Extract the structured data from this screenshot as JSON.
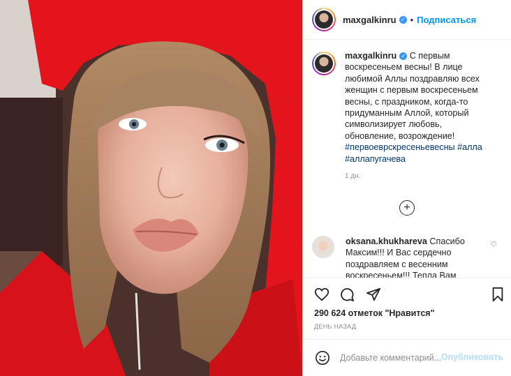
{
  "post": {
    "image_alt": "selfie photo in red hood",
    "author": {
      "username": "maxgalkinru",
      "verified": true,
      "follow_label": "Подписаться"
    },
    "header": {
      "dot": "•",
      "more_icon": "more-horizontal-icon"
    },
    "caption": {
      "username": "maxgalkinru",
      "text": "С первым воскресеньем весны! В лице любимой Аллы поздравляю всех женщин с первым воскресеньем весны, с праздником, когда-то придуманным Аллой, который символизирует любовь, обновление, возрождение!",
      "hashtags": [
        "#первоеврскресеньевесны",
        "#алла",
        "#аллапугачева"
      ],
      "time": "1 дн."
    },
    "comment": {
      "username": "oksana.khukhareva",
      "text": "Спасибо Максим!!! И Вас сердечно поздравляем с весенним воскресеньем!!! Тепла Вам"
    },
    "likes_text": "290 624 отметок \"Нравится\"",
    "posted_ago": "ДЕНЬ НАЗАД",
    "add_comment": {
      "placeholder": "Добавьте комментарий...",
      "publish_label": "Опубликовать"
    },
    "colors": {
      "accent": "#0095f6",
      "hood_red": "#e3141b",
      "text": "#262626",
      "muted": "#8e8e8e"
    }
  }
}
